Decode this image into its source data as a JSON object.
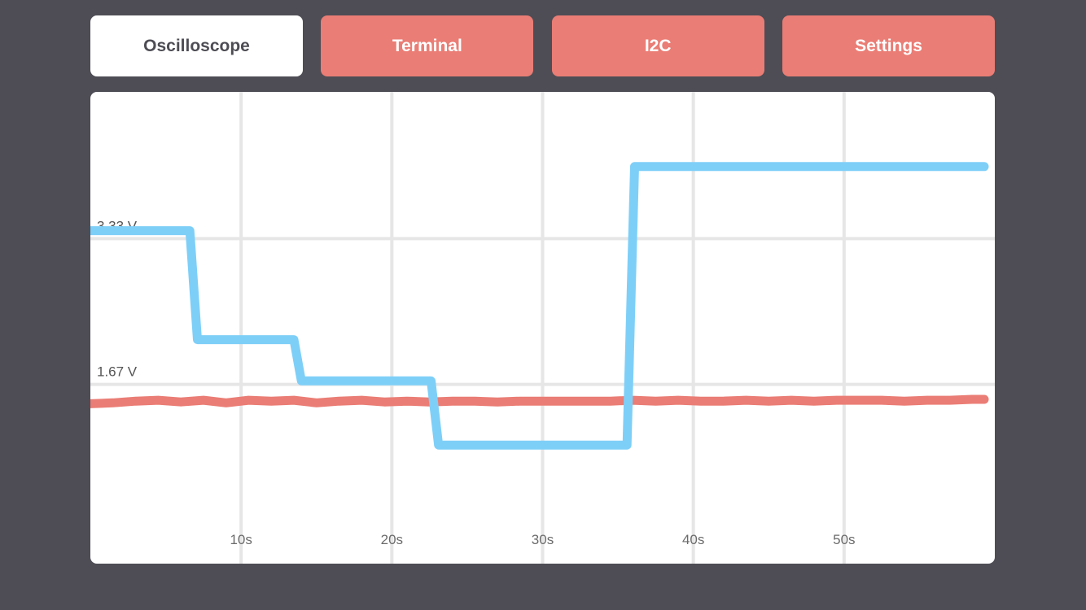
{
  "tabs": [
    {
      "label": "Oscilloscope",
      "active": true
    },
    {
      "label": "Terminal",
      "active": false
    },
    {
      "label": "I2C",
      "active": false
    },
    {
      "label": "Settings",
      "active": false
    }
  ],
  "colors": {
    "background": "#4e4d55",
    "tab_inactive": "#ea7d75",
    "tab_active": "#ffffff",
    "series_blue": "#7ecff8",
    "series_red": "#ea7d75",
    "grid": "#e6e6e6"
  },
  "chart_data": {
    "type": "line",
    "title": "",
    "xlabel": "",
    "ylabel": "",
    "xlim": [
      0,
      60
    ],
    "ylim": [
      0,
      5
    ],
    "x_ticks": [
      {
        "value": 10,
        "label": "10s"
      },
      {
        "value": 20,
        "label": "20s"
      },
      {
        "value": 30,
        "label": "30s"
      },
      {
        "value": 40,
        "label": "40s"
      },
      {
        "value": 50,
        "label": "50s"
      }
    ],
    "y_ticks": [
      {
        "value": 1.67,
        "label": "1.67 V"
      },
      {
        "value": 3.33,
        "label": "3.33 V"
      }
    ],
    "grid": true,
    "series": [
      {
        "color": "#7ecff8",
        "points": [
          [
            0,
            3.42
          ],
          [
            6.6,
            3.42
          ],
          [
            7.1,
            2.18
          ],
          [
            13.5,
            2.18
          ],
          [
            14.0,
            1.71
          ],
          [
            22.6,
            1.71
          ],
          [
            23.1,
            0.98
          ],
          [
            35.6,
            0.98
          ],
          [
            36.1,
            4.15
          ],
          [
            59.3,
            4.15
          ]
        ]
      },
      {
        "color": "#ea7d75",
        "points": [
          [
            0,
            1.45
          ],
          [
            1.5,
            1.46
          ],
          [
            3.0,
            1.48
          ],
          [
            4.5,
            1.49
          ],
          [
            6.0,
            1.47
          ],
          [
            7.5,
            1.49
          ],
          [
            9.0,
            1.46
          ],
          [
            10.5,
            1.49
          ],
          [
            12.0,
            1.48
          ],
          [
            13.5,
            1.49
          ],
          [
            15.0,
            1.46
          ],
          [
            16.5,
            1.48
          ],
          [
            18.0,
            1.49
          ],
          [
            19.5,
            1.47
          ],
          [
            21.0,
            1.48
          ],
          [
            22.5,
            1.47
          ],
          [
            24.0,
            1.48
          ],
          [
            25.5,
            1.48
          ],
          [
            27.0,
            1.47
          ],
          [
            28.5,
            1.48
          ],
          [
            30.0,
            1.48
          ],
          [
            31.5,
            1.48
          ],
          [
            33.0,
            1.48
          ],
          [
            34.5,
            1.48
          ],
          [
            36.0,
            1.49
          ],
          [
            37.5,
            1.48
          ],
          [
            39.0,
            1.49
          ],
          [
            40.5,
            1.48
          ],
          [
            42.0,
            1.48
          ],
          [
            43.5,
            1.49
          ],
          [
            45.0,
            1.48
          ],
          [
            46.5,
            1.49
          ],
          [
            48.0,
            1.48
          ],
          [
            49.5,
            1.49
          ],
          [
            51.0,
            1.49
          ],
          [
            52.5,
            1.49
          ],
          [
            54.0,
            1.48
          ],
          [
            55.5,
            1.49
          ],
          [
            57.0,
            1.49
          ],
          [
            58.5,
            1.5
          ],
          [
            59.3,
            1.5
          ]
        ]
      }
    ]
  }
}
